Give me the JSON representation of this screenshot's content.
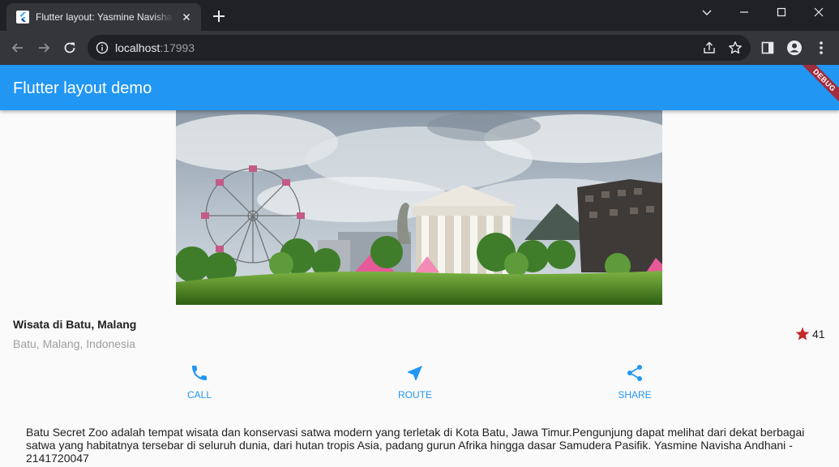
{
  "browser": {
    "tab_title": "Flutter layout: Yasmine Navisha Andhani",
    "url_host": "localhost",
    "url_port": ":17993"
  },
  "app": {
    "title": "Flutter layout demo",
    "debug_banner": "DEBUG",
    "accent_color": "#2196f3"
  },
  "place": {
    "title": "Wisata di Batu, Malang",
    "subtitle": "Batu, Malang, Indonesia",
    "rating": "41",
    "star_color": "#c62828"
  },
  "actions": [
    {
      "label": "CALL",
      "icon": "phone-icon"
    },
    {
      "label": "ROUTE",
      "icon": "near-me-icon"
    },
    {
      "label": "SHARE",
      "icon": "share-icon"
    }
  ],
  "description": "Batu Secret Zoo adalah tempat wisata dan konservasi satwa modern yang terletak di Kota Batu, Jawa Timur.Pengunjung dapat melihat dari dekat berbagai satwa yang habitatnya tersebar di seluruh dunia, dari hutan tropis Asia, padang gurun Afrika hingga dasar Samudera Pasifik. Yasmine Navisha Andhani - 2141720047"
}
